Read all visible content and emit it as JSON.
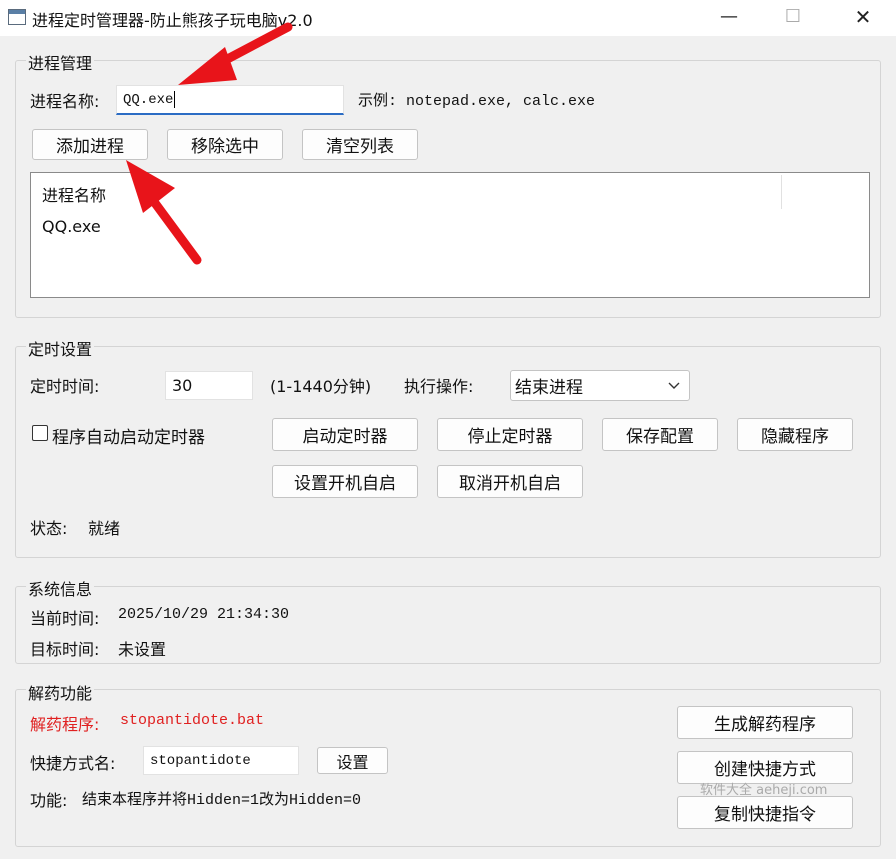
{
  "window": {
    "title": "进程定时管理器-防止熊孩子玩电脑v2.0",
    "minimize": "—",
    "maximize": "☐",
    "close": "✕"
  },
  "process_group": {
    "title": "进程管理",
    "name_label": "进程名称:",
    "name_value": "QQ.exe",
    "example": "示例: notepad.exe, calc.exe",
    "add_button": "添加进程",
    "remove_button": "移除选中",
    "clear_button": "清空列表",
    "list_header": "进程名称",
    "list_items": [
      "QQ.exe"
    ]
  },
  "timer_group": {
    "title": "定时设置",
    "time_label": "定时时间:",
    "time_value": "30",
    "range_hint": "(1-1440分钟)",
    "action_label": "执行操作:",
    "action_selected": "结束进程",
    "autostart_label": "程序自动启动定时器",
    "autostart_checked": false,
    "start_button": "启动定时器",
    "stop_button": "停止定时器",
    "save_button": "保存配置",
    "hide_button": "隐藏程序",
    "boot_on_button": "设置开机自启",
    "boot_off_button": "取消开机自启",
    "status_label": "状态:",
    "status_value": "就绪"
  },
  "system_group": {
    "title": "系统信息",
    "current_time_label": "当前时间:",
    "current_time_value": "2025/10/29 21:34:30",
    "target_time_label": "目标时间:",
    "target_time_value": "未设置"
  },
  "antidote_group": {
    "title": "解药功能",
    "program_label": "解药程序:",
    "program_value": "stopantidote.bat",
    "shortcut_label": "快捷方式名:",
    "shortcut_value": "stopantidote",
    "set_button": "设置",
    "function_label": "功能:",
    "function_value": "结束本程序并将Hidden=1改为Hidden=0",
    "generate_button": "生成解药程序",
    "create_shortcut_button": "创建快捷方式",
    "copy_command_button": "复制快捷指令"
  },
  "watermark": "软件大全 aeheji.com",
  "colors": {
    "accent": "#2b6cc4",
    "antidote_red": "#e02020",
    "arrow_red": "#e8141a"
  }
}
